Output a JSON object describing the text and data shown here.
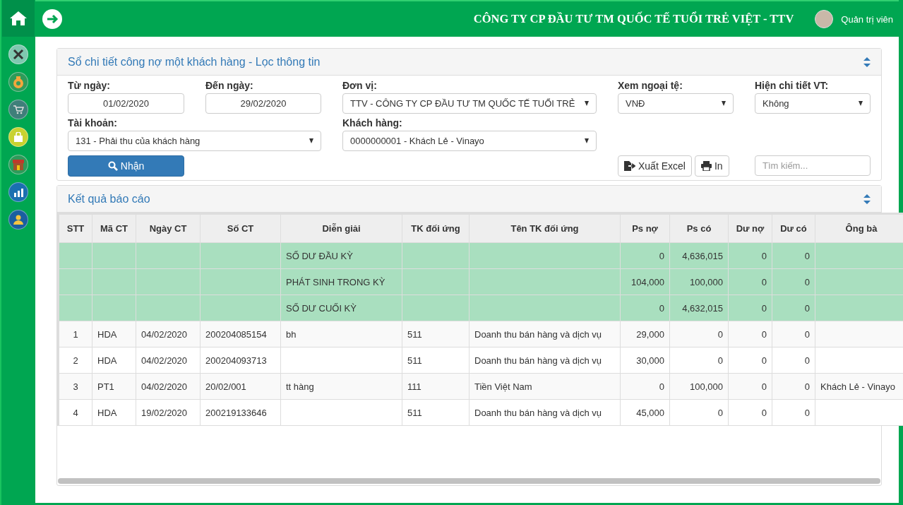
{
  "header": {
    "company": "CÔNG TY CP ĐẦU TƯ TM QUỐC TẾ TUỔI TRẺ VIỆT - TTV",
    "user": "Quản trị viên"
  },
  "filter_panel": {
    "title": "Sổ chi tiết công nợ một khách hàng - Lọc thông tin",
    "from_date": {
      "label": "Từ ngày:",
      "value": "01/02/2020"
    },
    "to_date": {
      "label": "Đến ngày:",
      "value": "29/02/2020"
    },
    "unit": {
      "label": "Đơn vị:",
      "value": "TTV - CÔNG TY CP ĐẦU TƯ TM QUỐC TẾ TUỔI TRẺ"
    },
    "currency": {
      "label": "Xem ngoại tệ:",
      "value": "VNĐ"
    },
    "detail": {
      "label": "Hiện chi tiết VT:",
      "value": "Không"
    },
    "account": {
      "label": "Tài khoản:",
      "value": "131 - Phải thu của khách hàng"
    },
    "customer": {
      "label": "Khách hàng:",
      "value": "0000000001 - Khách Lẻ - Vinayo"
    },
    "submit_button": "Nhận",
    "export_button": "Xuất Excel",
    "print_button": "In",
    "search": {
      "placeholder": "Tìm kiếm..."
    }
  },
  "result_panel": {
    "title": "Kết quả báo cáo",
    "table": {
      "columns": [
        "STT",
        "Mã CT",
        "Ngày CT",
        "Số CT",
        "Diễn giải",
        "TK đối ứng",
        "Tên TK đối ứng",
        "Ps nợ",
        "Ps có",
        "Dư nợ",
        "Dư có",
        "Ông bà"
      ],
      "rows": [
        {
          "kind": "summary",
          "cells": [
            null,
            null,
            null,
            null,
            "SỐ DƯ ĐẦU KỲ",
            null,
            null,
            "0",
            "4,636,015",
            "0",
            "0",
            null
          ]
        },
        {
          "kind": "summary",
          "cells": [
            null,
            null,
            null,
            null,
            "PHÁT SINH TRONG KỲ",
            null,
            null,
            "104,000",
            "100,000",
            "0",
            "0",
            null
          ]
        },
        {
          "kind": "summary",
          "cells": [
            null,
            null,
            null,
            null,
            "SỐ DƯ CUỐI KỲ",
            null,
            null,
            "0",
            "4,632,015",
            "0",
            "0",
            null
          ]
        },
        {
          "kind": "entry",
          "cells": [
            "1",
            "HDA",
            "04/02/2020",
            "200204085154",
            "bh",
            "511",
            "Doanh thu bán hàng và dịch vụ",
            "29,000",
            "0",
            "0",
            "0",
            null
          ]
        },
        {
          "kind": "entry",
          "cells": [
            "2",
            "HDA",
            "04/02/2020",
            "200204093713",
            null,
            "511",
            "Doanh thu bán hàng và dịch vụ",
            "30,000",
            "0",
            "0",
            "0",
            null
          ]
        },
        {
          "kind": "entry",
          "cells": [
            "3",
            "PT1",
            "04/02/2020",
            "20/02/001",
            "tt hàng",
            "111",
            "Tiền Việt Nam",
            "0",
            "100,000",
            "0",
            "0",
            "Khách Lẻ - Vinayo"
          ]
        },
        {
          "kind": "entry",
          "cells": [
            "4",
            "HDA",
            "19/02/2020",
            "200219133646",
            null,
            "511",
            "Doanh thu bán hàng và dịch vụ",
            "45,000",
            "0",
            "0",
            "0",
            null
          ]
        }
      ]
    }
  }
}
